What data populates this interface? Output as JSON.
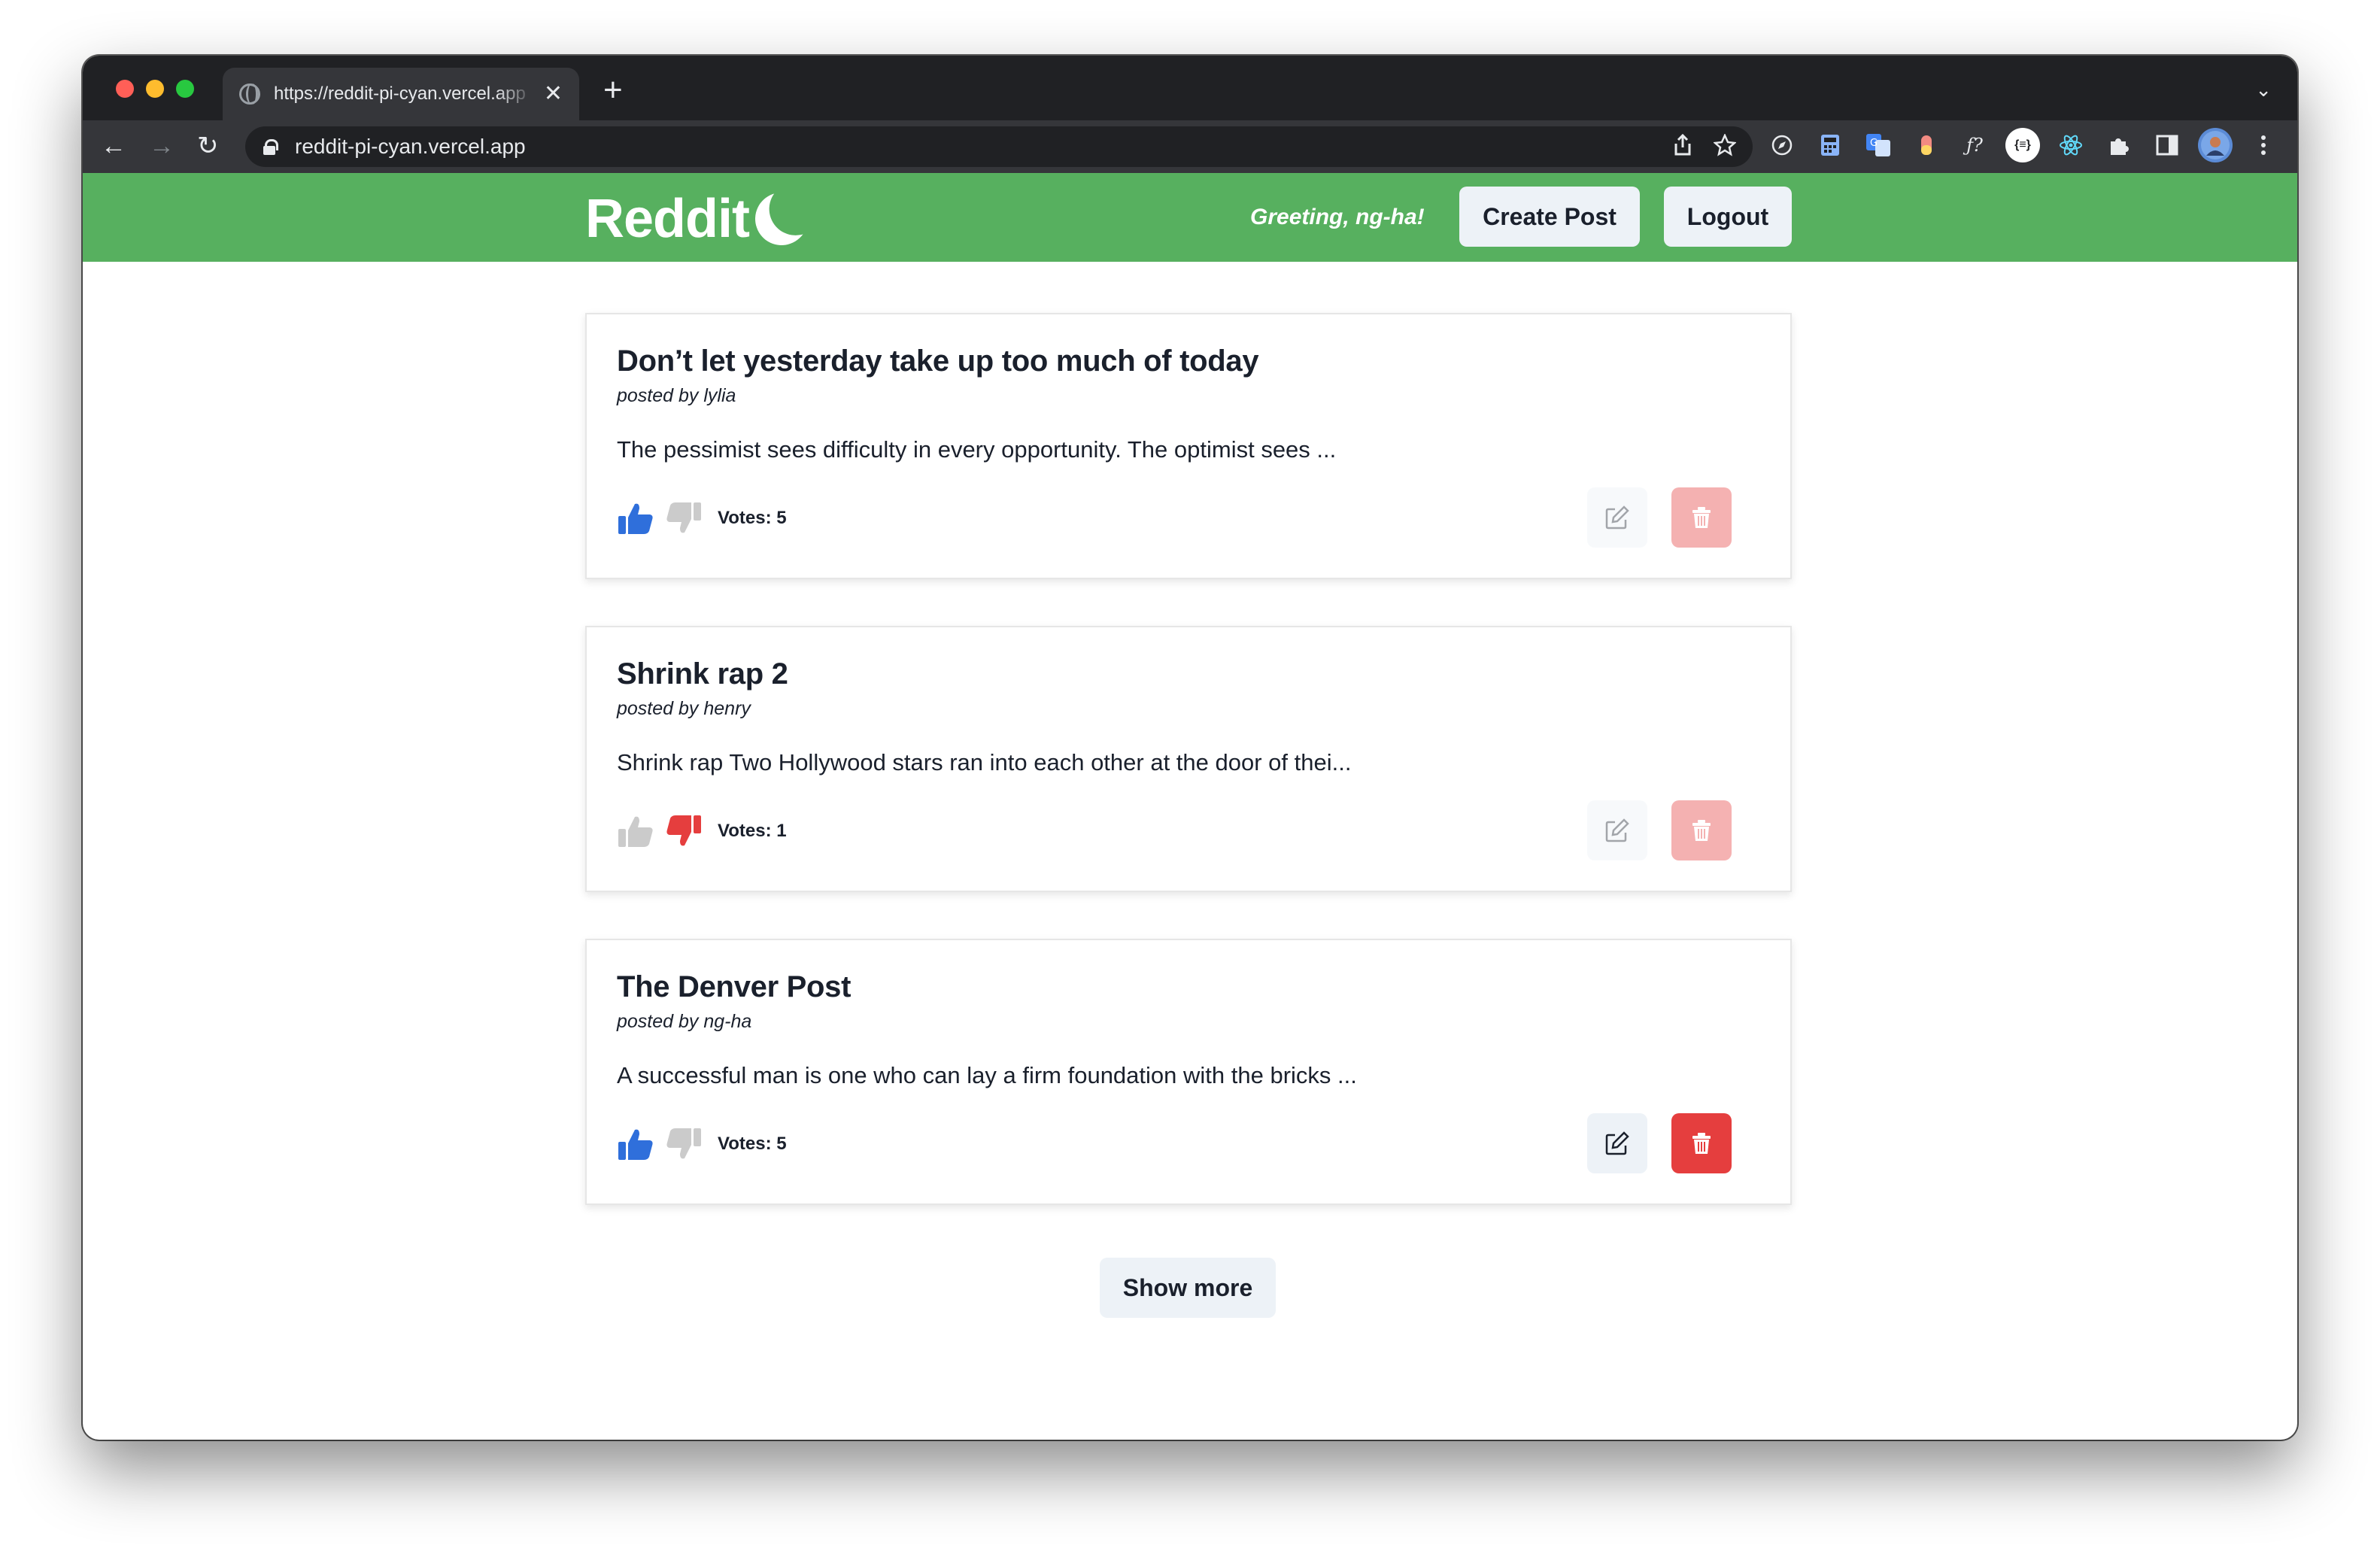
{
  "browser": {
    "tab_title": "https://reddit-pi-cyan.vercel.app",
    "tab_close": "✕",
    "new_tab": "+",
    "tab_menu": "⌄",
    "url": "reddit-pi-cyan.vercel.app",
    "nav": {
      "back": "←",
      "forward": "→",
      "reload": "↻"
    },
    "omni_icons": [
      "share-icon",
      "bookmark-star-icon"
    ],
    "extensions": [
      "compass-icon",
      "calculator-icon",
      "translate-icon",
      "capsule-icon",
      "function-icon",
      "json-icon",
      "react-icon",
      "puzzle-icon",
      "sidepanel-icon",
      "avatar",
      "more-icon"
    ]
  },
  "header": {
    "logo_text": "Reddit",
    "greeting": "Greeting, ng-ha!",
    "create_post_label": "Create Post",
    "logout_label": "Logout",
    "accent_color": "#57b05f"
  },
  "posts": [
    {
      "title": "Don’t let yesterday take up too much of today",
      "author": "posted by lylia",
      "body": "The pessimist sees difficulty in every opportunity. The optimist sees ...",
      "votes_label": "Votes: 5",
      "user_vote": "up",
      "owned_by_user": false
    },
    {
      "title": "Shrink rap 2",
      "author": "posted by henry",
      "body": "Shrink rap Two Hollywood stars ran into each other at the door of thei...",
      "votes_label": "Votes: 1",
      "user_vote": "down",
      "owned_by_user": false
    },
    {
      "title": "The Denver Post",
      "author": "posted by ng-ha",
      "body": "A successful man is one who can lay a firm foundation with the bricks ...",
      "votes_label": "Votes: 5",
      "user_vote": "up",
      "owned_by_user": true
    }
  ],
  "colors": {
    "upvote_active": "#2f6fdb",
    "downvote_active": "#e53e3e",
    "vote_inactive": "#cbcbcb",
    "delete": "#e53e3e"
  },
  "show_more_label": "Show more"
}
